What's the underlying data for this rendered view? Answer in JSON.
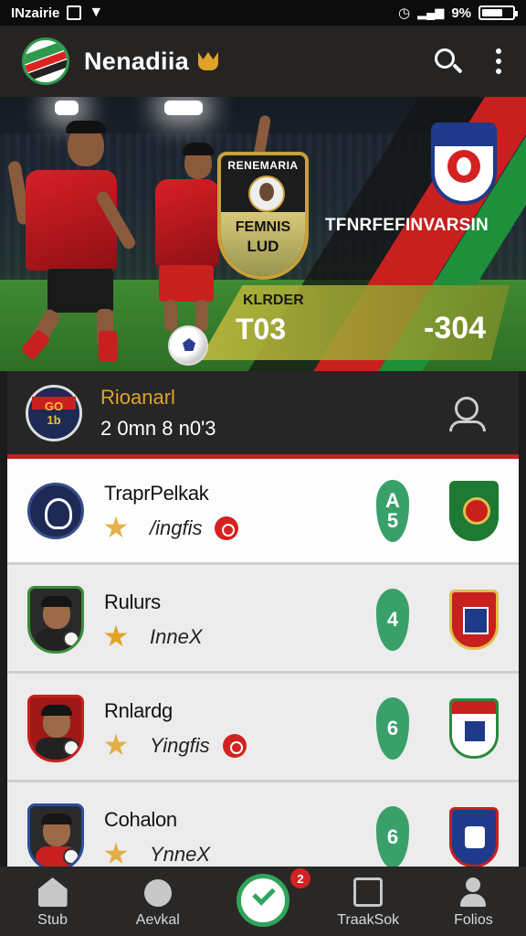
{
  "status_bar": {
    "carrier": "INzairie",
    "signal_text": "9%"
  },
  "app_bar": {
    "title": "Nenadiia"
  },
  "hero": {
    "crest_line1": "RENEMARIA",
    "crest_line2": "FEMNIS",
    "crest_line3": "LUD",
    "headline": "TFNRFEFINVARSIN",
    "strip_label": "KLRDER",
    "score_left": "T03",
    "score_right": "-304"
  },
  "featured": {
    "badge_text_top": "GO",
    "badge_text_bottom": "1b",
    "name": "Rioanarl",
    "subtitle": "2 0mn 8 n0'3"
  },
  "rows": [
    {
      "name": "TraprPelkak",
      "tag": "/ingfis",
      "pill": "A\n5"
    },
    {
      "name": "Rulurs",
      "tag": "InneX",
      "pill": "4"
    },
    {
      "name": "Rnlardg",
      "tag": "Yingfis",
      "pill": "6"
    },
    {
      "name": "Cohalon",
      "tag": "YnneX",
      "pill": "6"
    }
  ],
  "bottom_nav": {
    "items": [
      "Stub",
      "Aevkal",
      "",
      "TraakSok",
      "Folios"
    ],
    "badge_count": "2"
  },
  "colors": {
    "accent_red": "#c81f1f",
    "accent_green": "#2fa45a",
    "accent_gold": "#e0a329"
  }
}
